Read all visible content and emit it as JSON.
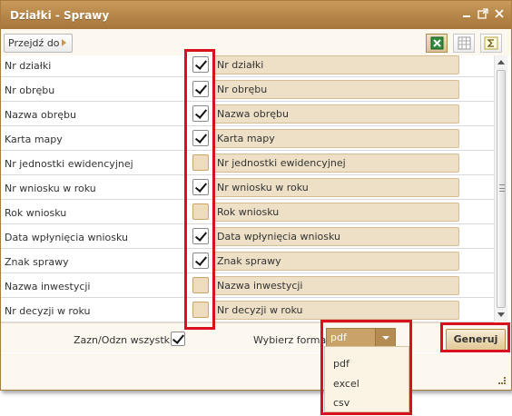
{
  "window": {
    "title": "Działki - Sprawy"
  },
  "titlebar_icons": [
    "minimize-icon",
    "popout-icon",
    "close-icon"
  ],
  "toolbar": {
    "goto_label": "Przejdź do",
    "format_icons": [
      "excel-icon",
      "table-icon",
      "sum-icon"
    ]
  },
  "rows": [
    {
      "label": "Nr działki",
      "checked": true,
      "field": "Nr działki"
    },
    {
      "label": "Nr obrębu",
      "checked": true,
      "field": "Nr obrębu"
    },
    {
      "label": "Nazwa obrębu",
      "checked": true,
      "field": "Nazwa obrębu"
    },
    {
      "label": "Karta mapy",
      "checked": true,
      "field": "Karta mapy"
    },
    {
      "label": "Nr jednostki ewidencyjnej",
      "checked": false,
      "field": "Nr jednostki ewidencyjnej"
    },
    {
      "label": "Nr wniosku w roku",
      "checked": true,
      "field": "Nr wniosku w roku"
    },
    {
      "label": "Rok wniosku",
      "checked": false,
      "field": "Rok wniosku"
    },
    {
      "label": "Data wpłynięcia wniosku",
      "checked": true,
      "field": "Data wpłynięcia wniosku"
    },
    {
      "label": "Znak sprawy",
      "checked": true,
      "field": "Znak sprawy"
    },
    {
      "label": "Nazwa inwestycji",
      "checked": false,
      "field": "Nazwa inwestycji"
    },
    {
      "label": "Nr decyzji w roku",
      "checked": false,
      "field": "Nr decyzji w roku"
    }
  ],
  "bottom": {
    "select_all_label": "Zazn/Odzn wszystkie:",
    "select_all_checked": true,
    "format_label": "Wybierz format",
    "format_selected": "pdf",
    "format_options": [
      "pdf",
      "excel",
      "csv"
    ],
    "generate_label": "Generuj"
  },
  "colors": {
    "titlebar": "#b6864a",
    "field_bg": "#ede0c6",
    "highlight": "#d9111e"
  }
}
